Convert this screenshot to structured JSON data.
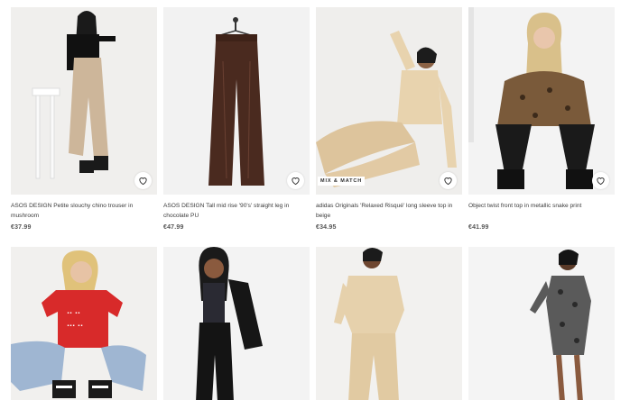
{
  "products": [
    {
      "title": "ASOS DESIGN Petite slouchy chino trouser in mushroom",
      "price": "€37.99",
      "badge": ""
    },
    {
      "title": "ASOS DESIGN Tall mid rise '90's' straight leg in chocolate PU",
      "price": "€47.99",
      "badge": ""
    },
    {
      "title": "adidas Originals 'Relaxed Risqué' long sleeve top in beige",
      "price": "€34.95",
      "badge": "MIX & MATCH"
    },
    {
      "title": "Object twist front top in metallic snake print",
      "price": "€41.99",
      "badge": ""
    }
  ],
  "icons": {
    "favourite": "heart-outline-icon"
  },
  "colors": {
    "text": "#2d2d2d",
    "price": "#555555",
    "image_bg": "#eeeeee",
    "badge_bg": "#ffffff"
  }
}
